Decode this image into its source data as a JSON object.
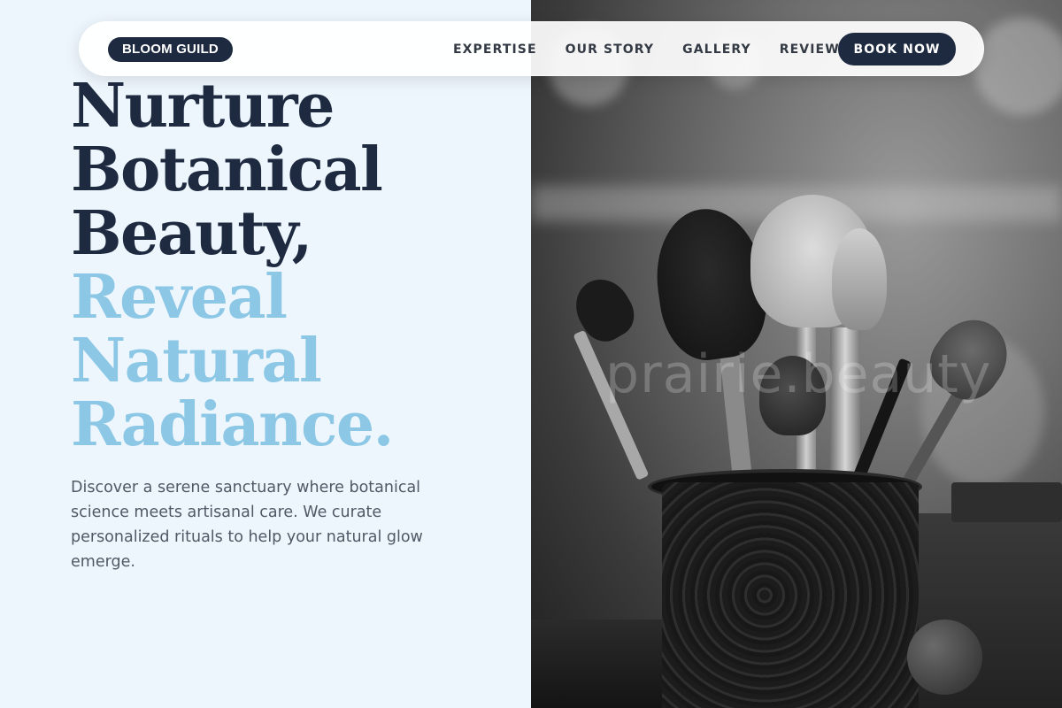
{
  "brand": {
    "logo_label": "BLOOM GUILD"
  },
  "nav": {
    "links": [
      {
        "label": "EXPERTISE"
      },
      {
        "label": "OUR STORY"
      },
      {
        "label": "GALLERY"
      },
      {
        "label": "REVIEWS"
      }
    ],
    "cta_label": "BOOK NOW"
  },
  "hero": {
    "title_lines_dark": [
      "Nurture",
      "Botanical",
      "Beauty,"
    ],
    "title_lines_light": [
      "Reveal",
      "Natural",
      "Radiance."
    ],
    "description": "Discover a serene sanctuary where botanical science meets artisanal care. We curate personalized rituals to help your natural glow emerge.",
    "image_watermark": "prairie.beauty"
  },
  "colors": {
    "navy": "#1d2a40",
    "sky": "#8cc8e6",
    "page_bg": "#eef6fd"
  }
}
